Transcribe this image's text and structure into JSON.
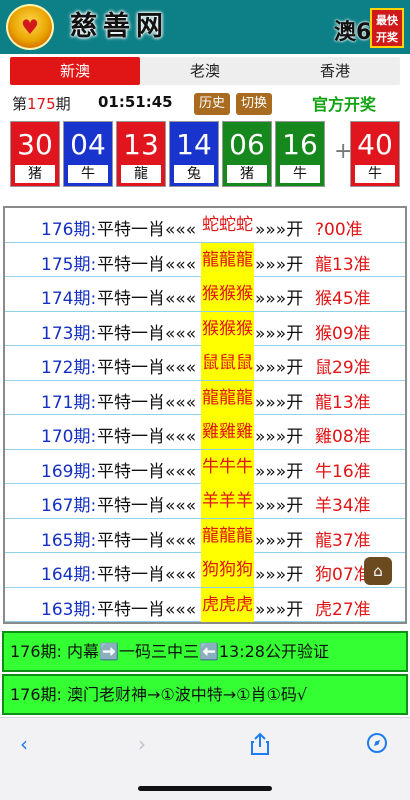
{
  "header": {
    "site_title": "慈善网",
    "right_title": "澳6",
    "fast_badge_line1": "最快",
    "fast_badge_line2": "开奖"
  },
  "tabs": [
    {
      "label": "新澳",
      "active": true
    },
    {
      "label": "老澳",
      "active": false
    },
    {
      "label": "香港",
      "active": false
    }
  ],
  "draw": {
    "period_prefix": "第",
    "period_num": "175",
    "period_suffix": "期",
    "time": "01:51:45",
    "history_label": "历史",
    "switch_label": "切换",
    "official_label": "官方开奖",
    "plus": "+",
    "balls": [
      {
        "num": "30",
        "zodiac": "猪",
        "color": "red"
      },
      {
        "num": "04",
        "zodiac": "牛",
        "color": "blue"
      },
      {
        "num": "13",
        "zodiac": "龍",
        "color": "red"
      },
      {
        "num": "14",
        "zodiac": "兔",
        "color": "blue"
      },
      {
        "num": "06",
        "zodiac": "猪",
        "color": "green"
      },
      {
        "num": "16",
        "zodiac": "牛",
        "color": "green"
      },
      {
        "num": "40",
        "zodiac": "牛",
        "color": "red"
      }
    ]
  },
  "predictions": [
    {
      "period": "176期:",
      "text": "平特一肖«««",
      "zodiac": "蛇蛇蛇",
      "arrow": "»»»开",
      "result": "?00准"
    },
    {
      "period": "175期:",
      "text": "平特一肖«««",
      "zodiac": "龍龍龍",
      "arrow": "»»»开",
      "result": "龍13准"
    },
    {
      "period": "174期:",
      "text": "平特一肖«««",
      "zodiac": "猴猴猴",
      "arrow": "»»»开",
      "result": "猴45准"
    },
    {
      "period": "173期:",
      "text": "平特一肖«««",
      "zodiac": "猴猴猴",
      "arrow": "»»»开",
      "result": "猴09准"
    },
    {
      "period": "172期:",
      "text": "平特一肖«««",
      "zodiac": "鼠鼠鼠",
      "arrow": "»»»开",
      "result": "鼠29准"
    },
    {
      "period": "171期:",
      "text": "平特一肖«««",
      "zodiac": "龍龍龍",
      "arrow": "»»»开",
      "result": "龍13准"
    },
    {
      "period": "170期:",
      "text": "平特一肖«««",
      "zodiac": "雞雞雞",
      "arrow": "»»»开",
      "result": "雞08准"
    },
    {
      "period": "169期:",
      "text": "平特一肖«««",
      "zodiac": "牛牛牛",
      "arrow": "»»»开",
      "result": "牛16准"
    },
    {
      "period": "167期:",
      "text": "平特一肖«««",
      "zodiac": "羊羊羊",
      "arrow": "»»»开",
      "result": "羊34准"
    },
    {
      "period": "165期:",
      "text": "平特一肖«««",
      "zodiac": "龍龍龍",
      "arrow": "»»»开",
      "result": "龍37准"
    },
    {
      "period": "164期:",
      "text": "平特一肖«««",
      "zodiac": "狗狗狗",
      "arrow": "»»»开",
      "result": "狗07准"
    },
    {
      "period": "163期:",
      "text": "平特一肖«««",
      "zodiac": "虎虎虎",
      "arrow": "»»»开",
      "result": "虎27准"
    }
  ],
  "banners": [
    {
      "text": "176期: 内幕➡️一码三中三⬅️13:28公开验证"
    },
    {
      "text": "176期: 澳门老财神→①波中特→①肖①码√"
    }
  ],
  "icons": {
    "home": "home-icon",
    "back": "chevron-left-icon",
    "forward": "chevron-right-icon",
    "share": "share-icon",
    "compass": "compass-icon"
  },
  "colors": {
    "header_bg": "#0d7f86",
    "tab_active": "#e01515",
    "ball_red": "#e0151d",
    "ball_blue": "#1834cc",
    "ball_green": "#17881d",
    "highlight": "#ffff00",
    "banner_bg": "#33ff33"
  }
}
